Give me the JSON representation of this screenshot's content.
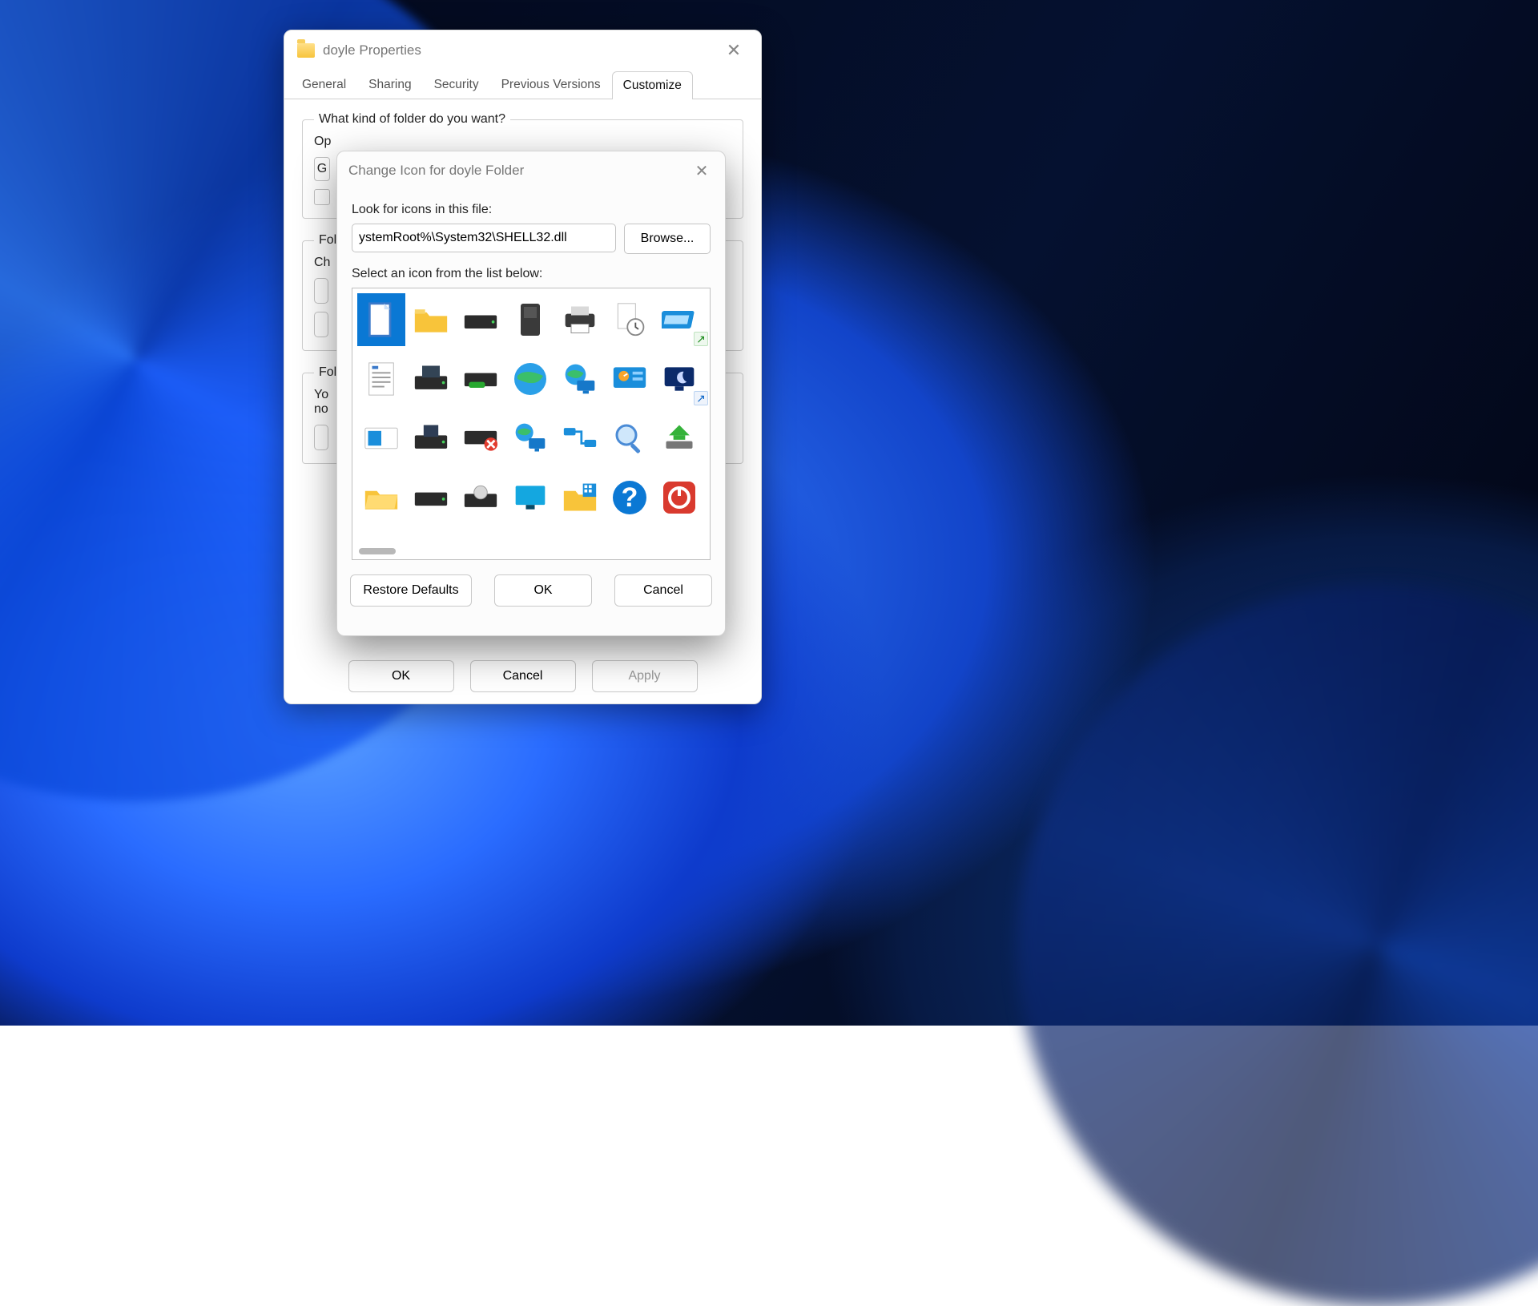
{
  "properties": {
    "title": "doyle Properties",
    "tabs": [
      "General",
      "Sharing",
      "Security",
      "Previous Versions",
      "Customize"
    ],
    "active_tab": "Customize",
    "group1_legend": "What kind of folder do you want?",
    "group1_line1_prefix": "Op",
    "group1_line2_prefix": "G",
    "group2_legend_prefix": "Fol",
    "group2_line1_prefix": "Ch",
    "group3_legend_prefix": "Fol",
    "group3_line1_prefix": "Yo",
    "group3_line2_prefix": "no",
    "buttons": {
      "ok": "OK",
      "cancel": "Cancel",
      "apply": "Apply"
    }
  },
  "change_icon": {
    "title": "Change Icon for doyle Folder",
    "look_label": "Look for icons in this file:",
    "path_value": "ystemRoot%\\System32\\SHELL32.dll",
    "browse": "Browse...",
    "select_label": "Select an icon from the list below:",
    "corner_share": "↗",
    "corner_shortcut": "↗",
    "icons": [
      "blank-document",
      "folder",
      "hard-drive",
      "chip",
      "printer",
      "document-clock",
      "run-dialog",
      "text-document",
      "floppy-drive",
      "removable-drive",
      "globe",
      "network-globe",
      "control-panel",
      "screensaver",
      "programs",
      "floppy-drive-alt",
      "drive-error",
      "network-computer",
      "network-connection",
      "search-magnifier",
      "eject-drive",
      "folder-open",
      "hard-drive-alt",
      "optical-drive",
      "monitor",
      "folder-apps",
      "help",
      "shutdown"
    ],
    "selected_index": 0,
    "buttons": {
      "restore": "Restore Defaults",
      "ok": "OK",
      "cancel": "Cancel"
    }
  }
}
